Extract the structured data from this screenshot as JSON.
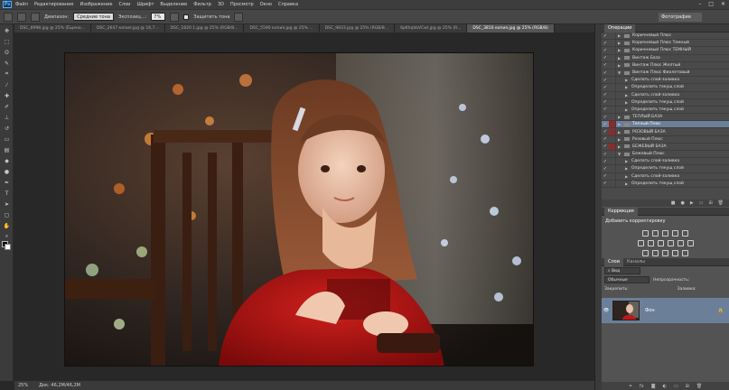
{
  "menubar": {
    "logo": "Ps",
    "items": [
      "Файл",
      "Редактирование",
      "Изображение",
      "Слои",
      "Шрифт",
      "Выделение",
      "Фильтр",
      "3D",
      "Просмотр",
      "Окно",
      "Справка"
    ],
    "controls": [
      "–",
      "□",
      "✕"
    ]
  },
  "options": {
    "range_label": "Диапазон:",
    "range_value": "Средние тона",
    "exposure_label": "Экспозиц...:",
    "exposure_value": "7%",
    "protect_label": "Защитить тона",
    "workspace": "Фотография"
  },
  "tabs": [
    "DSC_8998.jpg @ 25% (Ёщено...",
    "DSC_2647 копия.jpg @ 16,7...",
    "DSC_1820 1.jpg @ 25% (RGB/8...",
    "DSC_5590 копия.jpg @ 25% ...",
    "DSC_9833.jpg @ 25% (RGB/8...",
    "6pKhqVoVCwI.jpg @ 25% (R...",
    "DSC_3810 копия.jpg @ 25% (RGB/8)"
  ],
  "active_tab": 6,
  "status": {
    "zoom": "25%",
    "doc": "Док: 46,2M/46,2M"
  },
  "actions": {
    "tab_active": "Операции",
    "rows": [
      {
        "label": "Коричневый Плюс",
        "indent": 0,
        "dlg": false,
        "open": false
      },
      {
        "label": "Коричневый Плюс Темный",
        "indent": 0,
        "dlg": false,
        "open": false
      },
      {
        "label": "Коричневый Плюс ТЕМНЫЙ",
        "indent": 0,
        "dlg": false,
        "open": false
      },
      {
        "label": "Винтаж База",
        "indent": 0,
        "dlg": false,
        "open": false
      },
      {
        "label": "Винтаж Плюс Желтый",
        "indent": 0,
        "dlg": false,
        "open": false
      },
      {
        "label": "Винтаж Плюс Фиолетовый",
        "indent": 0,
        "dlg": false,
        "open": true
      },
      {
        "label": "Сделать слой-заливка",
        "indent": 1,
        "dlg": false,
        "open": false
      },
      {
        "label": "Определить текущ слой",
        "indent": 1,
        "dlg": false,
        "open": false
      },
      {
        "label": "Сделать слой-заливка",
        "indent": 1,
        "dlg": false,
        "open": false
      },
      {
        "label": "Определить текущ слой",
        "indent": 1,
        "dlg": false,
        "open": false
      },
      {
        "label": "Определить текущ слой",
        "indent": 1,
        "dlg": false,
        "open": false
      },
      {
        "label": "ТЕПЛЫЙ БАЗА",
        "indent": 0,
        "dlg": false,
        "open": false
      },
      {
        "label": "Теплый Плюс",
        "indent": 0,
        "dlg": true,
        "open": false,
        "selected": true
      },
      {
        "label": "РОЗОВЫЙ БАЗА",
        "indent": 0,
        "dlg": true,
        "open": false
      },
      {
        "label": "Розовый Плюс",
        "indent": 0,
        "dlg": false,
        "open": false
      },
      {
        "label": "БЕЖЕВЫЙ БАЗА",
        "indent": 0,
        "dlg": true,
        "open": false
      },
      {
        "label": "Бежевый Плюс",
        "indent": 0,
        "dlg": false,
        "open": true
      },
      {
        "label": "Сделать слой-заливка",
        "indent": 1,
        "dlg": false,
        "open": false
      },
      {
        "label": "Определить текущ слой",
        "indent": 1,
        "dlg": false,
        "open": false
      },
      {
        "label": "Сделать слой-заливка",
        "indent": 1,
        "dlg": false,
        "open": false
      },
      {
        "label": "Определить текущ слой",
        "indent": 1,
        "dlg": false,
        "open": false
      }
    ]
  },
  "adjustments": {
    "tab": "Коррекция",
    "title": "Добавить корректировку"
  },
  "layers": {
    "tab_active": "Слои",
    "tab_other": "Каналы",
    "kind": "Вид",
    "blend": "Обычные",
    "opacity_label": "Непрозрачность:",
    "lock_label": "Закрепить:",
    "fill_label": "Заливка:",
    "layer_name": "Фон"
  }
}
